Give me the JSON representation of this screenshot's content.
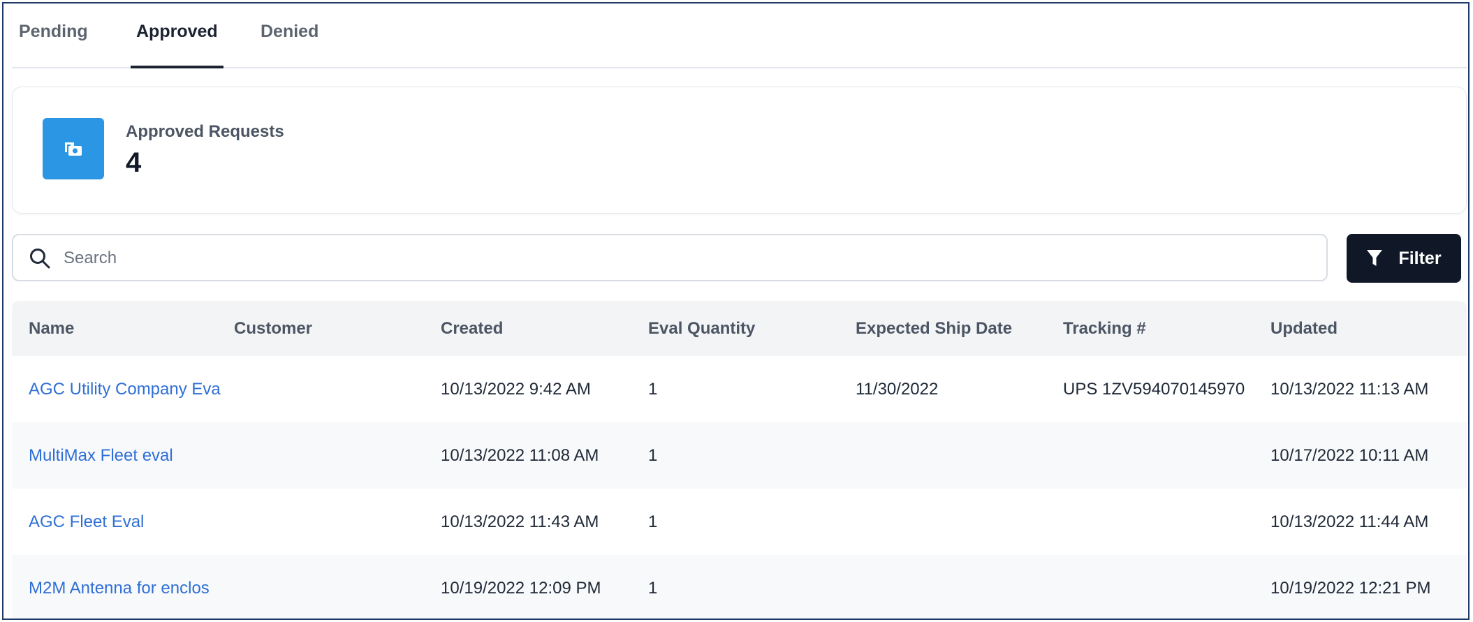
{
  "tabs": [
    {
      "label": "Pending"
    },
    {
      "label": "Approved"
    },
    {
      "label": "Denied"
    }
  ],
  "active_tab": "Approved",
  "summary": {
    "label": "Approved Requests",
    "count": "4",
    "icon": "camera-icon",
    "icon_color": "#2b96e3"
  },
  "search": {
    "placeholder": "Search",
    "value": ""
  },
  "filter": {
    "label": "Filter",
    "icon": "funnel-icon"
  },
  "table": {
    "columns": [
      "Name",
      "Customer",
      "Created",
      "Eval Quantity",
      "Expected Ship Date",
      "Tracking #",
      "Updated"
    ],
    "rows": [
      {
        "name": "AGC Utility Company Eva",
        "customer": "",
        "created": "10/13/2022 9:42 AM",
        "qty": "1",
        "ship": "11/30/2022",
        "tracking": "UPS 1ZV594070145970\t",
        "updated": "10/13/2022 11:13 AM"
      },
      {
        "name": "MultiMax Fleet eval",
        "customer": "",
        "created": "10/13/2022 11:08 AM",
        "qty": "1",
        "ship": "",
        "tracking": "",
        "updated": "10/17/2022 10:11 AM"
      },
      {
        "name": "AGC Fleet Eval",
        "customer": "",
        "created": "10/13/2022 11:43 AM",
        "qty": "1",
        "ship": "",
        "tracking": "",
        "updated": "10/13/2022 11:44 AM"
      },
      {
        "name": "M2M Antenna for enclos",
        "customer": "",
        "created": "10/19/2022 12:09 PM",
        "qty": "1",
        "ship": "",
        "tracking": "",
        "updated": "10/19/2022 12:21 PM"
      }
    ]
  },
  "colors": {
    "link": "#2f6fd6",
    "dark": "#101828",
    "frame": "#1f3a68"
  }
}
